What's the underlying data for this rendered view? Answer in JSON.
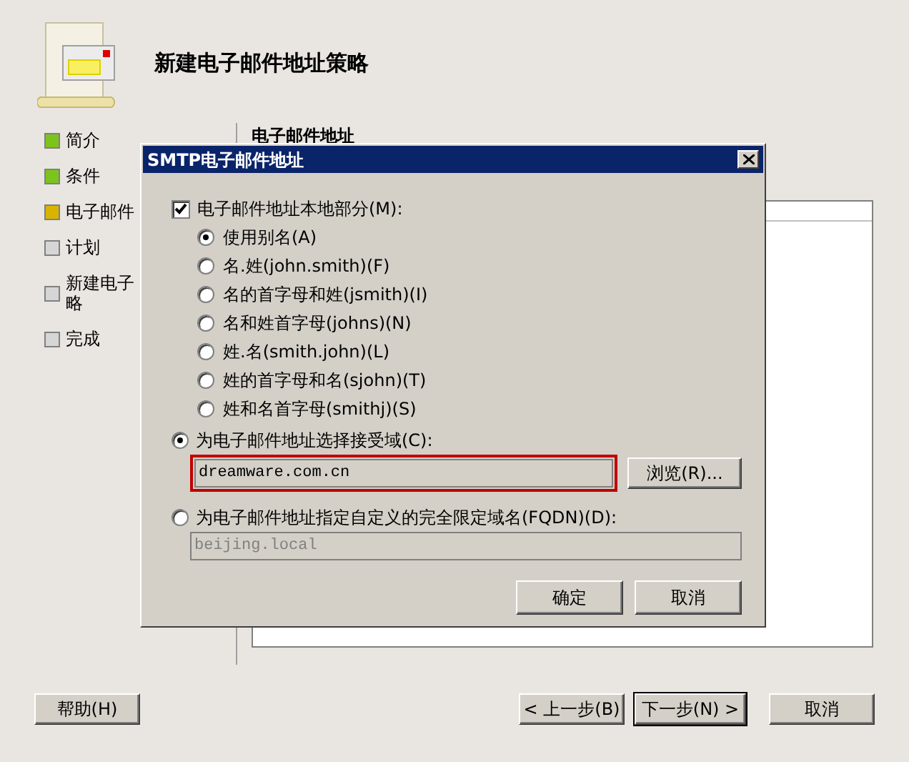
{
  "wizard": {
    "title": "新建电子邮件地址策略",
    "steps": [
      {
        "lines": [
          "简介"
        ],
        "done": true,
        "current": false
      },
      {
        "lines": [
          "条件"
        ],
        "done": true,
        "current": false
      },
      {
        "lines": [
          "电子邮件"
        ],
        "done": false,
        "current": true
      },
      {
        "lines": [
          "计划"
        ],
        "done": false,
        "current": false
      },
      {
        "lines": [
          "新建电子",
          "略"
        ],
        "done": false,
        "current": false
      },
      {
        "lines": [
          "完成"
        ],
        "done": false,
        "current": false
      }
    ],
    "section_heading": "电子邮件地址",
    "help_button": "帮助(H)",
    "back_button": "< 上一步(B)",
    "next_button": "下一步(N) >",
    "cancel_button": "取消"
  },
  "dialog": {
    "title": "SMTP电子邮件地址",
    "local_part": {
      "label": "电子邮件地址本地部分(M):",
      "checked": true,
      "options": [
        {
          "label": "使用别名(A)",
          "selected": true
        },
        {
          "label": "名.姓(john.smith)(F)",
          "selected": false
        },
        {
          "label": "名的首字母和姓(jsmith)(I)",
          "selected": false
        },
        {
          "label": "名和姓首字母(johns)(N)",
          "selected": false
        },
        {
          "label": "姓.名(smith.john)(L)",
          "selected": false
        },
        {
          "label": "姓的首字母和名(sjohn)(T)",
          "selected": false
        },
        {
          "label": "姓和名首字母(smithj)(S)",
          "selected": false
        }
      ]
    },
    "domain_options": [
      {
        "label": "为电子邮件地址选择接受域(C):",
        "selected": true,
        "field": {
          "value": "dreamware.com.cn",
          "disabled": false,
          "highlighted": true
        },
        "browse_button": "浏览(R)..."
      },
      {
        "label": "为电子邮件地址指定自定义的完全限定域名(FQDN)(D):",
        "selected": false,
        "field": {
          "value": "beijing.local",
          "disabled": true,
          "highlighted": false
        }
      }
    ],
    "ok_button": "确定",
    "cancel_button": "取消"
  }
}
